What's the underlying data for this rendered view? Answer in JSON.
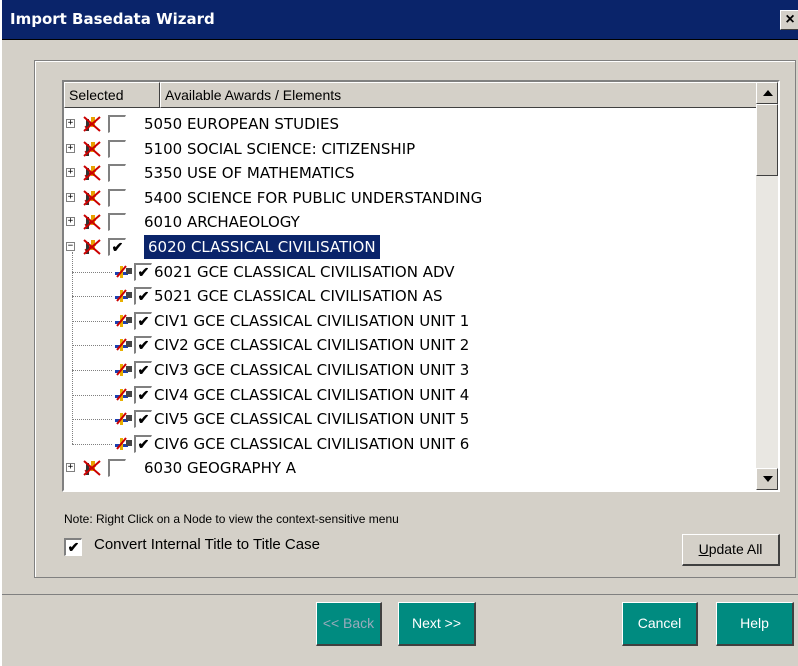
{
  "window": {
    "title": "Import Basedata Wizard",
    "close_label": "×"
  },
  "tree": {
    "columns": [
      "Selected",
      "Available Awards / Elements"
    ],
    "rows": [
      {
        "label": "5050 EUROPEAN STUDIES",
        "checked": false,
        "level": 0,
        "expander": "+"
      },
      {
        "label": "5100 SOCIAL SCIENCE: CITIZENSHIP",
        "checked": false,
        "level": 0,
        "expander": "+"
      },
      {
        "label": "5350 USE OF MATHEMATICS",
        "checked": false,
        "level": 0,
        "expander": "+"
      },
      {
        "label": "5400 SCIENCE FOR PUBLIC UNDERSTANDING",
        "checked": false,
        "level": 0,
        "expander": "+"
      },
      {
        "label": "6010 ARCHAEOLOGY",
        "checked": false,
        "level": 0,
        "expander": "+"
      },
      {
        "label": "6020 CLASSICAL CIVILISATION",
        "checked": true,
        "level": 0,
        "expander": "−",
        "selected": true
      },
      {
        "label": "6021 GCE CLASSICAL CIVILISATION ADV",
        "checked": true,
        "level": 1
      },
      {
        "label": "5021 GCE CLASSICAL CIVILISATION AS",
        "checked": true,
        "level": 1
      },
      {
        "label": "CIV1 GCE CLASSICAL CIVILISATION UNIT 1",
        "checked": true,
        "level": 1
      },
      {
        "label": "CIV2 GCE CLASSICAL CIVILISATION UNIT 2",
        "checked": true,
        "level": 1
      },
      {
        "label": "CIV3 GCE CLASSICAL CIVILISATION UNIT 3",
        "checked": true,
        "level": 1
      },
      {
        "label": "CIV4 GCE CLASSICAL CIVILISATION UNIT 4",
        "checked": true,
        "level": 1
      },
      {
        "label": "CIV5 GCE CLASSICAL CIVILISATION UNIT 5",
        "checked": true,
        "level": 1
      },
      {
        "label": "CIV6 GCE CLASSICAL CIVILISATION UNIT 6",
        "checked": true,
        "level": 1
      },
      {
        "label": "6030 GEOGRAPHY A",
        "checked": false,
        "level": 0,
        "expander": "+"
      }
    ]
  },
  "note": "Note: Right Click on a Node to view the context-sensitive menu",
  "convert": {
    "label": "Convert Internal Title to Title Case",
    "checked": true,
    "check_glyph": "✔"
  },
  "buttons": {
    "update_first": "U",
    "update_rest": "pdate All",
    "back": "<< Back",
    "next": "Next >>",
    "cancel": "Cancel",
    "help": "Help"
  },
  "colors": {
    "title_bar": "#0a246a",
    "selection": "#0a246a",
    "nav_button": "#008b80",
    "dialog": "#d4d0c8"
  }
}
